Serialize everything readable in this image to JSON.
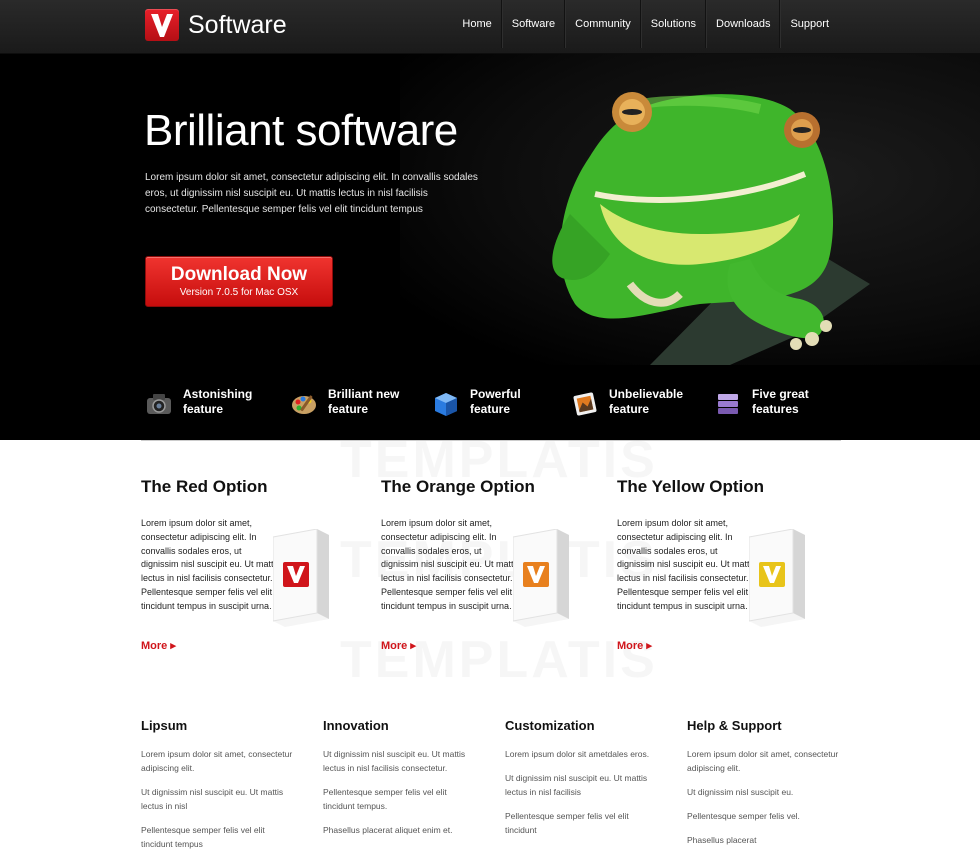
{
  "header": {
    "logo_text": "Software",
    "nav": [
      "Home",
      "Software",
      "Community",
      "Solutions",
      "Downloads",
      "Support"
    ]
  },
  "hero": {
    "title": "Brilliant software",
    "text": "Lorem ipsum dolor sit amet, consectetur adipiscing elit. In convallis sodales eros, ut dignissim nisl suscipit eu. Ut mattis lectus in nisl facilisis consectetur. Pellentesque semper felis vel elit tincidunt tempus",
    "download": {
      "label": "Download Now",
      "version": "Version 7.0.5 for Mac OSX"
    },
    "features": [
      {
        "line1": "Astonishing",
        "line2": "feature",
        "icon": "camera-icon"
      },
      {
        "line1": "Brilliant new",
        "line2": "feature",
        "icon": "palette-icon"
      },
      {
        "line1": "Powerful",
        "line2": "feature",
        "icon": "cube-icon"
      },
      {
        "line1": "Unbelievable",
        "line2": "feature",
        "icon": "picture-icon"
      },
      {
        "line1": "Five great",
        "line2": "features",
        "icon": "stack-icon"
      }
    ]
  },
  "watermark": "TEMPLATIS",
  "options": [
    {
      "title": "The Red Option",
      "text": "Lorem ipsum dolor sit amet, consectetur adipiscing elit. In convallis sodales eros, ut dignissim nisl suscipit eu. Ut mattis lectus in nisl facilisis consectetur. Pellentesque semper felis vel elit tincidunt tempus in suscipit urna.",
      "more": "More ▸",
      "color": "#d0151b"
    },
    {
      "title": "The Orange Option",
      "text": "Lorem ipsum dolor sit amet, consectetur adipiscing elit. In convallis sodales eros, ut dignissim nisl suscipit eu. Ut mattis lectus in nisl facilisis consectetur. Pellentesque semper felis vel elit tincidunt tempus in suscipit urna.",
      "more": "More ▸",
      "color": "#e8801e"
    },
    {
      "title": "The Yellow Option",
      "text": "Lorem ipsum dolor sit amet, consectetur adipiscing elit. In convallis sodales eros, ut dignissim nisl suscipit eu. Ut mattis lectus in nisl facilisis consectetur. Pellentesque semper felis vel elit tincidunt tempus in suscipit urna.",
      "more": "More ▸",
      "color": "#e8c41a"
    }
  ],
  "columns": [
    {
      "title": "Lipsum",
      "items": [
        "Lorem ipsum dolor sit amet, consectetur adipiscing elit.",
        "Ut dignissim nisl suscipit eu. Ut mattis lectus in nisl",
        "Pellentesque semper felis vel elit tincidunt tempus"
      ]
    },
    {
      "title": "Innovation",
      "items": [
        "Ut dignissim nisl suscipit eu. Ut mattis lectus in nisl facilisis consectetur.",
        "Pellentesque semper felis vel elit tincidunt tempus.",
        "Phasellus placerat aliquet enim et."
      ]
    },
    {
      "title": "Customization",
      "items": [
        "Lorem ipsum dolor sit ametdales eros.",
        "Ut dignissim nisl suscipit eu. Ut mattis lectus in nisl facilisis",
        "Pellentesque semper felis vel elit tincidunt"
      ]
    },
    {
      "title": "Help & Support",
      "items": [
        "Lorem ipsum dolor sit amet, consectetur adipiscing elit.",
        "Ut dignissim nisl suscipit eu.",
        "Pellentesque semper felis vel.",
        "Phasellus placerat"
      ]
    }
  ]
}
